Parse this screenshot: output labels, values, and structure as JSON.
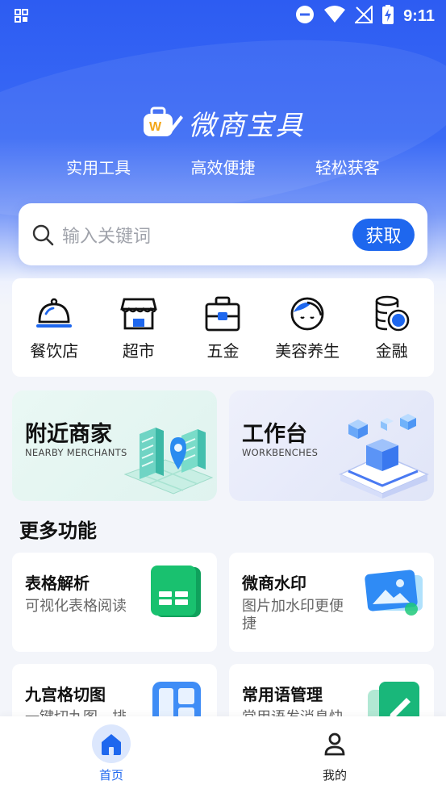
{
  "status_bar": {
    "time": "9:11"
  },
  "header": {
    "app_name": "微商宝具",
    "slogans": [
      "实用工具",
      "高效便捷",
      "轻松获客"
    ]
  },
  "search": {
    "placeholder": "输入关键词",
    "button_label": "获取"
  },
  "categories": [
    {
      "label": "餐饮店",
      "icon": "cloche-icon"
    },
    {
      "label": "超市",
      "icon": "store-icon"
    },
    {
      "label": "五金",
      "icon": "toolbox-icon"
    },
    {
      "label": "美容养生",
      "icon": "woman-face-icon"
    },
    {
      "label": "金融",
      "icon": "coins-icon"
    }
  ],
  "features": [
    {
      "title": "附近商家",
      "subtitle": "NEARBY MERCHANTS"
    },
    {
      "title": "工作台",
      "subtitle": "WORKBENCHES"
    }
  ],
  "more": {
    "title": "更多功能",
    "tools": [
      {
        "name": "表格解析",
        "desc": "可视化表格阅读"
      },
      {
        "name": "微商水印",
        "desc": "图片加水印更便捷"
      },
      {
        "name": "九宫格切图",
        "desc": "一键切九图，排"
      },
      {
        "name": "常用语管理",
        "desc": "常用语发消息快"
      }
    ]
  },
  "tabs": [
    {
      "label": "首页",
      "active": true
    },
    {
      "label": "我的",
      "active": false
    }
  ],
  "colors": {
    "primary": "#1e67ee",
    "hero_top": "#2d5cf2",
    "excel_green": "#12b76a"
  }
}
